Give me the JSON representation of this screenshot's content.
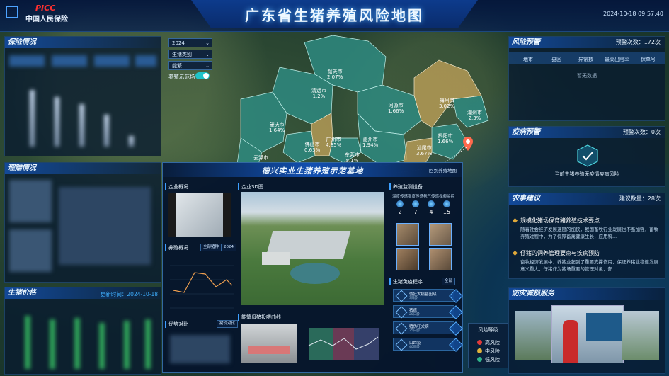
{
  "header": {
    "title": "广东省生猪养殖风险地图",
    "logo_brand": "PICC",
    "logo_text": "中国人民保险",
    "datetime": "2024-10-18 09:57:40"
  },
  "left": {
    "insurance": {
      "title": "保险情况"
    },
    "claims": {
      "title": "理赔情况"
    },
    "price": {
      "title": "生猪价格",
      "update_label": "更新时间：2024-10-18"
    }
  },
  "filters": {
    "year": "2024",
    "category": "生猪类别",
    "metric": "能繁",
    "toggle_label": "养殖示范场"
  },
  "map": {
    "regions": [
      {
        "name": "韶关市",
        "value": "2.07%"
      },
      {
        "name": "清远市",
        "value": "1.2%"
      },
      {
        "name": "河源市",
        "value": "1.66%"
      },
      {
        "name": "梅州市",
        "value": "3.02%"
      },
      {
        "name": "潮州市",
        "value": "2.3%"
      },
      {
        "name": "肇庆市",
        "value": "1.64%"
      },
      {
        "name": "惠州市",
        "value": "1.94%"
      },
      {
        "name": "揭阳市",
        "value": "1.66%"
      },
      {
        "name": "汕尾市",
        "value": "3.67%"
      },
      {
        "name": "佛山市",
        "value": "0.63%"
      },
      {
        "name": "广州市",
        "value": "4.85%"
      },
      {
        "name": "东莞市",
        "value": "5.1%"
      },
      {
        "name": "云浮市",
        "value": ""
      }
    ]
  },
  "right": {
    "risk": {
      "title": "风险预警",
      "count_label": "预警次数：172次",
      "columns": [
        "地市",
        "县区",
        "异常数",
        "最高出险率",
        "保单号"
      ],
      "empty": "暂无数据"
    },
    "epidemic": {
      "title": "疫病预警",
      "count_label": "预警次数：0次",
      "message": "当前生猪养殖无疫情疫病风险"
    },
    "advice": {
      "title": "农事建议",
      "count_label": "建议数量：28次",
      "items": [
        {
          "title": "规模化猪场保育猪养殖技术要点",
          "body": "随着社会经济发展速度的加快，我国畜牧行业发展也不断加强，畜牧养殖过程中，为了保障畜禽健康生长，应用科..."
        },
        {
          "title": "仔猪的饲养管理要点与疾病预防",
          "body": "畜牧经济发展中，养猪业起到了重要支撑作用，保证养猪业稳健发展意义重大，仔猪作为猪场重要的管理对象，部..."
        }
      ]
    },
    "service": {
      "title": "防灾减损服务"
    }
  },
  "modal": {
    "title": "德兴实业生猪养殖示范基地",
    "close_label": "回到养殖地图",
    "sections": {
      "overview": "企业概况",
      "view3d": "企业3D图",
      "devices": "养殖监测设备",
      "breeding": "养殖概况",
      "breeding_select": "全部猪种",
      "breeding_year": "2024",
      "procedure": "生猪免疫程序",
      "procedure_select": "全部",
      "advantage": "优势对比",
      "advantage_select": "猪价对比",
      "sow": "能繁母猪投喂曲线"
    },
    "devices": [
      {
        "label": "温度传感",
        "count": "2"
      },
      {
        "label": "湿度传感",
        "count": "7"
      },
      {
        "label": "氨气传感",
        "count": "4"
      },
      {
        "label": "视频监控",
        "count": "15"
      }
    ],
    "procedures": [
      {
        "label": "伪狂犬病基因缺",
        "sub": "3日龄"
      },
      {
        "label": "猪瘟",
        "sub": "20日龄"
      },
      {
        "label": "猪伪狂犬病",
        "sub": "35日龄"
      },
      {
        "label": "口蹄疫",
        "sub": "40日龄"
      }
    ]
  },
  "legend": {
    "title": "风险等级",
    "items": [
      {
        "label": "高风险",
        "color": "#e03a3a"
      },
      {
        "label": "中风险",
        "color": "#e0b23a"
      },
      {
        "label": "低风险",
        "color": "#2fb38a"
      }
    ]
  }
}
